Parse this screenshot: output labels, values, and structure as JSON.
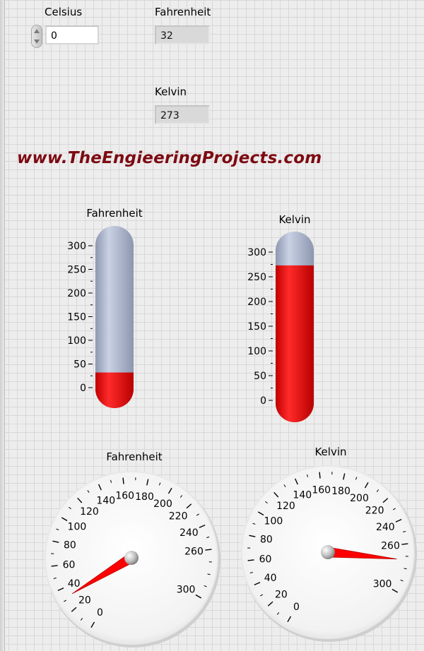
{
  "controls": {
    "celsius": {
      "label": "Celsius",
      "value": "0"
    },
    "fahrenheit": {
      "label": "Fahrenheit",
      "value": "32"
    },
    "kelvin": {
      "label": "Kelvin",
      "value": "273"
    }
  },
  "watermark": "www.TheEngieeringProjects.com",
  "thermometers": [
    {
      "id": "fahrenheit",
      "title": "Fahrenheit",
      "min": 0,
      "max": 300,
      "value": 32,
      "ticks": [
        "0",
        "50",
        "100",
        "150",
        "200",
        "250",
        "300"
      ]
    },
    {
      "id": "kelvin",
      "title": "Kelvin",
      "min": 0,
      "max": 300,
      "value": 273,
      "ticks": [
        "0",
        "50",
        "100",
        "150",
        "200",
        "250",
        "300"
      ]
    }
  ],
  "gauges": [
    {
      "id": "fahrenheit",
      "title": "Fahrenheit",
      "min": 0,
      "max": 300,
      "value": 32,
      "ticks": [
        "0",
        "20",
        "40",
        "60",
        "80",
        "100",
        "120",
        "140",
        "160",
        "180",
        "200",
        "220",
        "240",
        "260",
        "300"
      ]
    },
    {
      "id": "kelvin",
      "title": "Kelvin",
      "min": 0,
      "max": 300,
      "value": 273,
      "ticks": [
        "0",
        "20",
        "40",
        "60",
        "80",
        "100",
        "120",
        "140",
        "160",
        "180",
        "200",
        "220",
        "240",
        "260",
        "300"
      ]
    }
  ],
  "colors": {
    "fill_red": "#ff1a1a",
    "tube_empty": "#aab4cc",
    "needle": "#ff0000",
    "watermark": "#7d0a12"
  },
  "icons": {
    "stepper": "up-down-arrows-icon"
  }
}
